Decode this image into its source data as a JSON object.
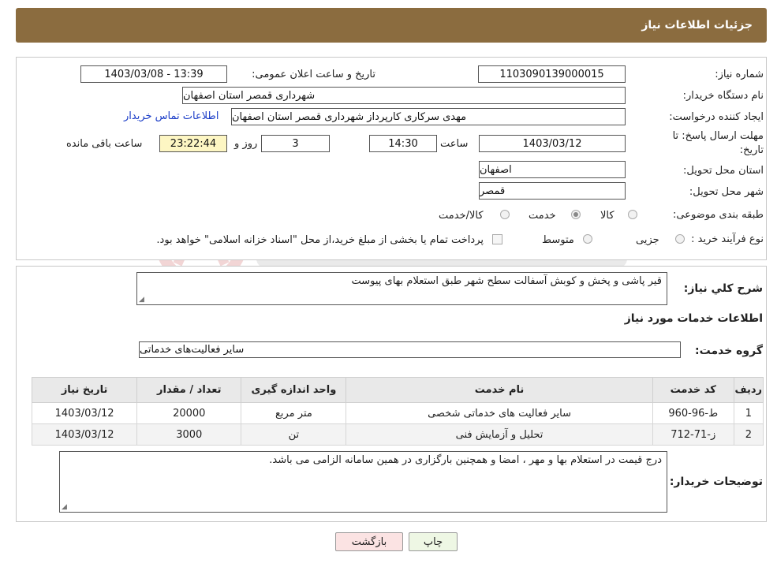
{
  "header": {
    "title": "جزئیات اطلاعات نیاز"
  },
  "form": {
    "need_number_label": "شماره نیاز:",
    "need_number": "1103090139000015",
    "announce_label": "تاریخ و ساعت اعلان عمومی:",
    "announce_value": "1403/03/08 - 13:39",
    "buyer_org_label": "نام دستگاه خریدار:",
    "buyer_org": "شهرداری قمصر استان اصفهان",
    "creator_label": "ایجاد کننده درخواست:",
    "creator": "مهدی سرکاری کارپرداز شهرداری قمصر استان اصفهان",
    "contact_link": "اطلاعات تماس خریدار",
    "deadline_label_1": "مهلت ارسال پاسخ: تا",
    "deadline_label_2": "تاریخ:",
    "deadline_date": "1403/03/12",
    "time_label": "ساعت",
    "deadline_time": "14:30",
    "days_value": "3",
    "days_label": "روز و",
    "remaining_time": "23:22:44",
    "remaining_label": "ساعت باقی مانده",
    "province_label": "استان محل تحویل:",
    "province": "اصفهان",
    "city_label": "شهر محل تحویل:",
    "city": "قمصر",
    "category_label": "طبقه بندی موضوعی:",
    "category_options": [
      "کالا",
      "خدمت",
      "کالا/خدمت"
    ],
    "category_selected": "خدمت",
    "purchase_type_label": "نوع فرآیند خرید :",
    "purchase_options": [
      "جزیی",
      "متوسط"
    ],
    "payment_note": "پرداخت تمام یا بخشی از مبلغ خرید،از محل \"اسناد خزانه اسلامی\" خواهد بود."
  },
  "details": {
    "description_label": "شرح کلي نياز:",
    "description": "قیر پاشی و پخش و کوبش آسفالت سطح شهر طبق استعلام بهای پیوست",
    "services_title": "اطلاعات خدمات مورد نیاز",
    "service_group_label": "گروه خدمت:",
    "service_group": "سایر فعالیت‌های خدماتی",
    "table": {
      "headers": [
        "ردیف",
        "کد خدمت",
        "نام خدمت",
        "واحد اندازه گیری",
        "تعداد / مقدار",
        "تاریخ نیاز"
      ],
      "rows": [
        [
          "1",
          "ط-96-960",
          "سایر فعالیت های خدماتی شخصی",
          "متر مربع",
          "20000",
          "1403/03/12"
        ],
        [
          "2",
          "ز-71-712",
          "تحلیل و آزمایش فنی",
          "تن",
          "3000",
          "1403/03/12"
        ]
      ]
    },
    "buyer_notes_label": "توضیحات خریدار:",
    "buyer_notes": "درج قیمت در استعلام بها و مهر ، امضا و همچنین بارگزاری در همین سامانه الزامی می باشد."
  },
  "buttons": {
    "print": "چاپ",
    "back": "بازگشت"
  },
  "colors": {
    "header": "#8b6c3f",
    "back_button": "#fbe3e3",
    "print_button": "#eef7e4",
    "link": "#1a3cc7"
  }
}
